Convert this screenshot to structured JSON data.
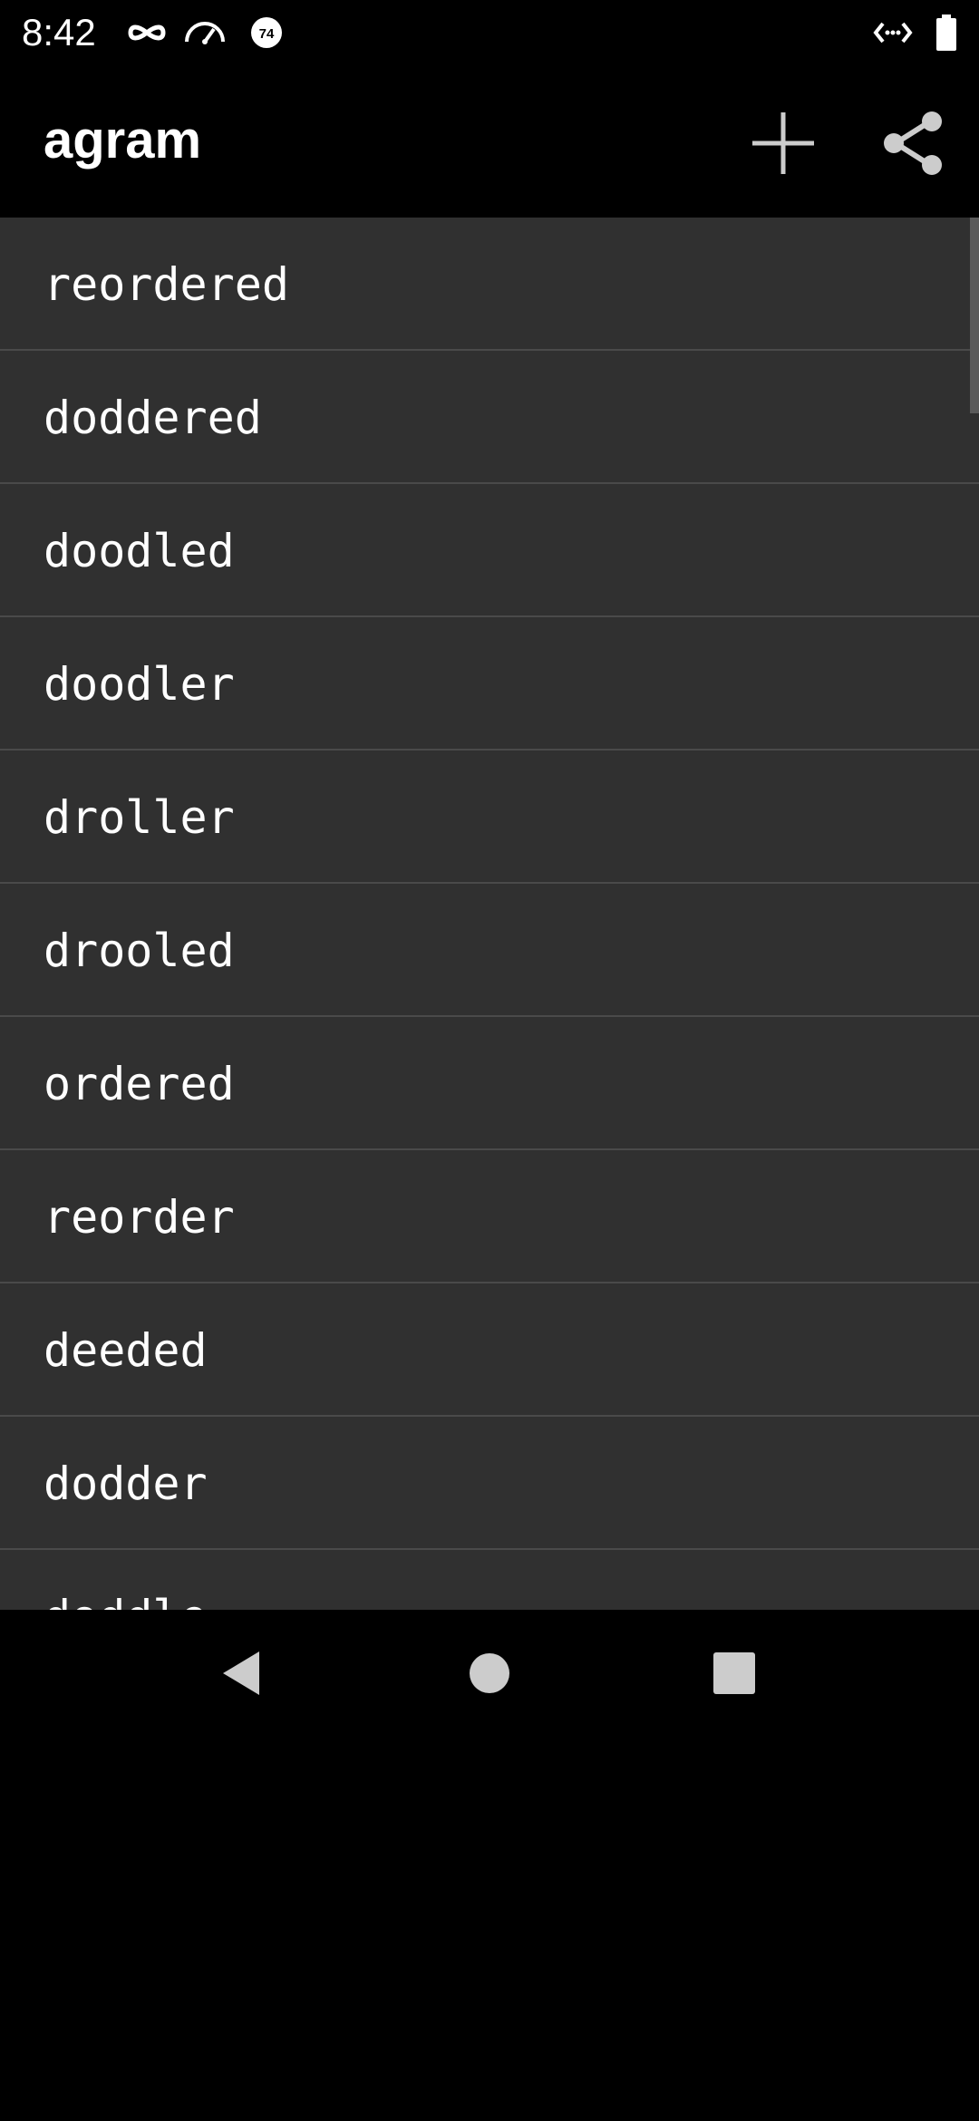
{
  "status_bar": {
    "time": "8:42",
    "icons": [
      "incognito-icon",
      "speedometer-icon",
      "temperature-icon",
      "data-saver-icon",
      "battery-icon"
    ],
    "badge_value": "74"
  },
  "app_bar": {
    "title": "agram",
    "actions": [
      "add-icon",
      "share-icon"
    ]
  },
  "list": {
    "items": [
      "reordered",
      "doddered",
      "doodled",
      "doodler",
      "droller",
      "drooled",
      "ordered",
      "reorder",
      "deeded",
      "dodder",
      "doddle"
    ]
  },
  "nav_bar": {
    "buttons": [
      "back-icon",
      "home-icon",
      "recents-icon"
    ]
  },
  "colors": {
    "background": "#000000",
    "list_background": "#303030",
    "divider": "#4a4a4a",
    "icon": "#cccccc",
    "text": "#ffffff"
  }
}
